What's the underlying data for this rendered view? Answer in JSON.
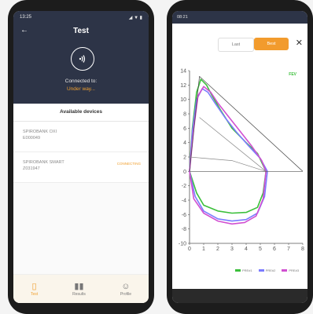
{
  "phone1": {
    "status_time": "13:25",
    "status_icons": "◢ ▼ ▮",
    "title": "Test",
    "connected_label": "Connected to:",
    "connected_status": "Under way...",
    "available_label": "Available devices",
    "devices": [
      {
        "name": "SPIROBANK OXI",
        "serial": "E000049",
        "state": ""
      },
      {
        "name": "SPIROBANK SMART",
        "serial": "Z031947",
        "state": "CONNECTING"
      }
    ],
    "tabs": [
      {
        "label": "Test",
        "icon": "device-icon"
      },
      {
        "label": "Results",
        "icon": "bar-chart-icon"
      },
      {
        "label": "Profile",
        "icon": "person-icon"
      }
    ]
  },
  "phone2": {
    "status_time": "08:21",
    "toggle": {
      "last": "Last",
      "best": "Best"
    },
    "corner_label": "FEV",
    "colors": {
      "green": "#3bbf3b",
      "blue": "#7b7bff",
      "pink": "#d14fd1",
      "orange": "#f29b2d"
    },
    "legend": [
      {
        "label": "PRE#1",
        "color": "#3bbf3b"
      },
      {
        "label": "PRE#2",
        "color": "#7b7bff"
      },
      {
        "label": "PRE#3",
        "color": "#d14fd1"
      }
    ]
  },
  "chart_data": {
    "type": "line",
    "xlim": [
      0,
      8
    ],
    "ylim": [
      -10,
      14
    ],
    "x_ticks": [
      0,
      1,
      2,
      3,
      4,
      5,
      6,
      7,
      8
    ],
    "y_ticks": [
      14,
      12,
      10,
      8,
      6,
      4,
      2,
      0,
      -2,
      -4,
      -6,
      -8,
      -10
    ],
    "grid": false,
    "series": [
      {
        "color": "#3bbf3b",
        "points": [
          [
            0,
            0
          ],
          [
            0.2,
            6
          ],
          [
            0.5,
            11
          ],
          [
            0.8,
            12.8
          ],
          [
            1.2,
            12
          ],
          [
            1.6,
            10.5
          ],
          [
            2.2,
            8.5
          ],
          [
            3,
            6
          ],
          [
            4,
            4
          ],
          [
            4.8,
            2.5
          ],
          [
            5.4,
            0
          ],
          [
            5.2,
            -3
          ],
          [
            4.8,
            -5
          ],
          [
            4,
            -5.7
          ],
          [
            3,
            -5.8
          ],
          [
            2,
            -5.5
          ],
          [
            1,
            -4.7
          ],
          [
            0.5,
            -3
          ],
          [
            0,
            0
          ]
        ]
      },
      {
        "color": "#7b7bff",
        "points": [
          [
            0,
            0
          ],
          [
            0.2,
            5.5
          ],
          [
            0.5,
            10
          ],
          [
            0.9,
            11.5
          ],
          [
            1.3,
            11
          ],
          [
            1.8,
            9.5
          ],
          [
            2.5,
            7.5
          ],
          [
            3.3,
            5.5
          ],
          [
            4.2,
            3.5
          ],
          [
            5,
            1.8
          ],
          [
            5.5,
            0
          ],
          [
            5.3,
            -3.5
          ],
          [
            4.8,
            -5.8
          ],
          [
            4,
            -6.7
          ],
          [
            3,
            -6.9
          ],
          [
            2,
            -6.6
          ],
          [
            1,
            -5.5
          ],
          [
            0.4,
            -3.5
          ],
          [
            0,
            0
          ]
        ]
      },
      {
        "color": "#d14fd1",
        "points": [
          [
            0,
            0
          ],
          [
            0.3,
            6
          ],
          [
            0.6,
            10.5
          ],
          [
            1,
            11.8
          ],
          [
            1.5,
            11
          ],
          [
            2,
            9.5
          ],
          [
            2.8,
            7.5
          ],
          [
            3.6,
            5.5
          ],
          [
            4.4,
            3.5
          ],
          [
            5.1,
            1.5
          ],
          [
            5.4,
            0
          ],
          [
            5.2,
            -3.8
          ],
          [
            4.7,
            -6.2
          ],
          [
            3.9,
            -7.1
          ],
          [
            3,
            -7.3
          ],
          [
            2,
            -6.9
          ],
          [
            1,
            -5.8
          ],
          [
            0.3,
            -3.8
          ],
          [
            0,
            0
          ]
        ]
      },
      {
        "color": "#444444",
        "points": [
          [
            0,
            0
          ],
          [
            0.7,
            13.2
          ],
          [
            8,
            0
          ]
        ]
      },
      {
        "color": "#888888",
        "points": [
          [
            0.7,
            7.5
          ],
          [
            5.4,
            0
          ]
        ]
      },
      {
        "color": "#888888",
        "points": [
          [
            0,
            2
          ],
          [
            3,
            1.5
          ],
          [
            5.4,
            0
          ]
        ]
      },
      {
        "color": "#555555",
        "points": [
          [
            0,
            0
          ],
          [
            8,
            0
          ]
        ]
      }
    ]
  }
}
